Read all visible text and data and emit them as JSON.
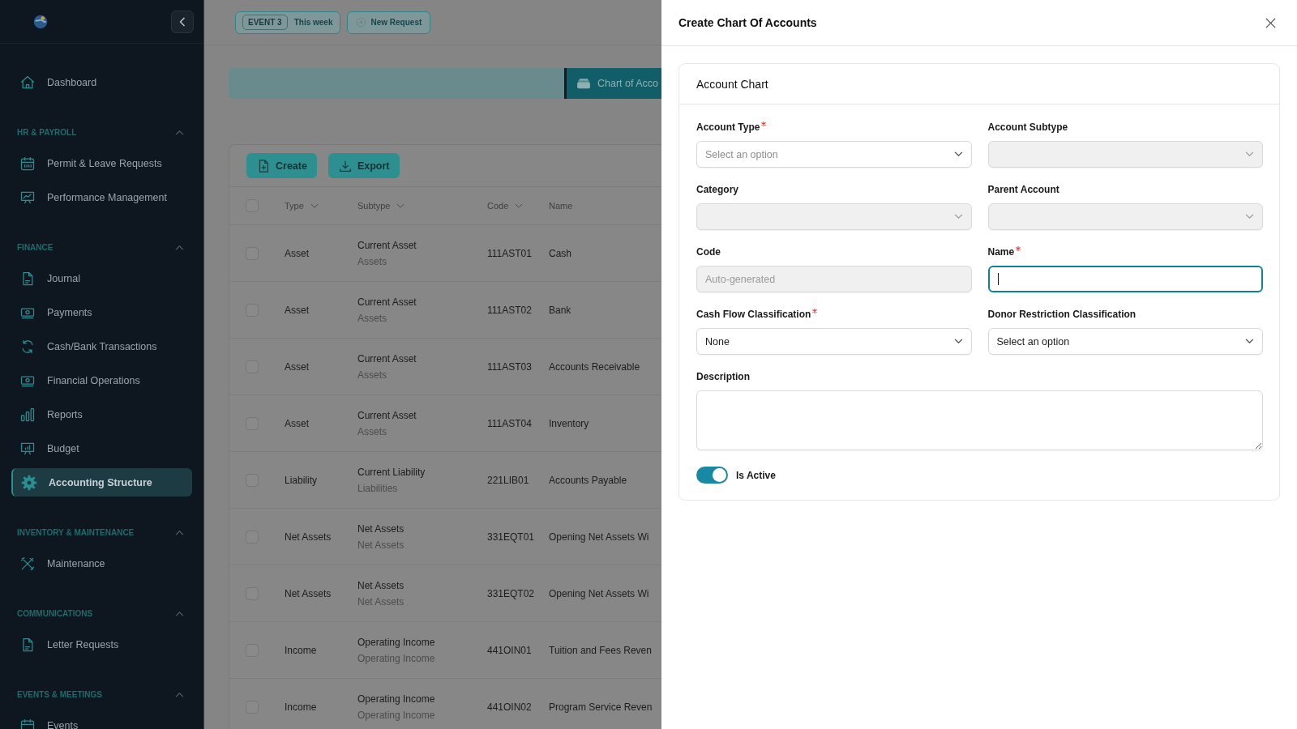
{
  "sidebar": {
    "sections": [
      {
        "items": [
          {
            "label": "Dashboard",
            "selected": false
          }
        ]
      },
      {
        "title": "HR & PAYROLL",
        "expanded": true,
        "items": [
          {
            "label": "Permit & Leave Requests",
            "selected": false
          },
          {
            "label": "Performance Management",
            "selected": false
          }
        ]
      },
      {
        "title": "FINANCE",
        "expanded": true,
        "items": [
          {
            "label": "Journal",
            "selected": false
          },
          {
            "label": "Payments",
            "selected": false
          },
          {
            "label": "Cash/Bank Transactions",
            "selected": false
          },
          {
            "label": "Financial Operations",
            "selected": false
          },
          {
            "label": "Reports",
            "selected": false
          },
          {
            "label": "Budget",
            "selected": false
          },
          {
            "label": "Accounting Structure",
            "selected": true
          }
        ]
      },
      {
        "title": "INVENTORY & MAINTENANCE",
        "expanded": true,
        "items": [
          {
            "label": "Maintenance",
            "selected": false
          }
        ]
      },
      {
        "title": "COMMUNICATIONS",
        "expanded": true,
        "items": [
          {
            "label": "Letter Requests",
            "selected": false
          }
        ]
      },
      {
        "title": "EVENTS & MEETINGS",
        "expanded": true,
        "items": [
          {
            "label": "Events",
            "selected": false
          }
        ]
      }
    ]
  },
  "top_bar": {
    "event_chip": {
      "badge": "EVENT 3",
      "label": "This week"
    },
    "new_request": "New Request"
  },
  "banner": {
    "tab": "Chart of Acco"
  },
  "toolbar": {
    "buttons": [
      "Create",
      "Export"
    ]
  },
  "table": {
    "select_all": {
      "checked": false
    },
    "columns": [
      {
        "label": "Type",
        "sortable": true
      },
      {
        "label": "Subtype",
        "sortable": true
      },
      {
        "label": "Code",
        "sortable": true
      },
      {
        "label": "Name",
        "sortable": false
      }
    ],
    "rows": [
      {
        "checked": false,
        "type": "Asset",
        "subtype": "Current Asset",
        "group": "Assets",
        "code": "111AST01",
        "name": "Cash"
      },
      {
        "checked": false,
        "type": "Asset",
        "subtype": "Current Asset",
        "group": "Assets",
        "code": "111AST02",
        "name": "Bank"
      },
      {
        "checked": false,
        "type": "Asset",
        "subtype": "Current Asset",
        "group": "Assets",
        "code": "111AST03",
        "name": "Accounts Receivable"
      },
      {
        "checked": false,
        "type": "Asset",
        "subtype": "Current Asset",
        "group": "Assets",
        "code": "111AST04",
        "name": "Inventory"
      },
      {
        "checked": false,
        "type": "Liability",
        "subtype": "Current Liability",
        "group": "Liabilities",
        "code": "221LIB01",
        "name": "Accounts Payable"
      },
      {
        "checked": false,
        "type": "Net Assets",
        "subtype": "Net Assets",
        "group": "Net Assets",
        "code": "331EQT01",
        "name": "Opening Net Assets Wi"
      },
      {
        "checked": false,
        "type": "Net Assets",
        "subtype": "Net Assets",
        "group": "Net Assets",
        "code": "331EQT02",
        "name": "Opening Net Assets Wi"
      },
      {
        "checked": false,
        "type": "Income",
        "subtype": "Operating Income",
        "group": "Operating Income",
        "code": "441OIN01",
        "name": "Tuition and Fees Reven"
      },
      {
        "checked": false,
        "type": "Income",
        "subtype": "Operating Income",
        "group": "Operating Income",
        "code": "441OIN02",
        "name": "Program Service Reven"
      }
    ]
  },
  "drawer": {
    "title": "Create Chart Of Accounts",
    "card_title": "Account Chart",
    "fields": [
      {
        "label": "Account Type",
        "required": true,
        "kind": "select",
        "placeholder": "Select an option",
        "disabled": false
      },
      {
        "label": "Account Subtype",
        "required": false,
        "kind": "select",
        "disabled": true
      },
      {
        "label": "Category",
        "required": false,
        "kind": "select",
        "disabled": true
      },
      {
        "label": "Parent Account",
        "required": false,
        "kind": "select",
        "disabled": true
      },
      {
        "label": "Code",
        "required": false,
        "kind": "text",
        "placeholder": "Auto-generated",
        "disabled": true
      },
      {
        "label": "Name",
        "required": true,
        "kind": "text",
        "disabled": false,
        "focused": true
      },
      {
        "label": "Cash Flow Classification",
        "required": true,
        "kind": "select",
        "value": "None",
        "disabled": false
      },
      {
        "label": "Donor Restriction Classification",
        "required": false,
        "kind": "select",
        "value": "Select an option",
        "disabled": false
      },
      {
        "label": "Description",
        "required": false,
        "kind": "textarea",
        "disabled": false
      }
    ],
    "toggle": {
      "label": "Is Active",
      "on": true
    }
  }
}
